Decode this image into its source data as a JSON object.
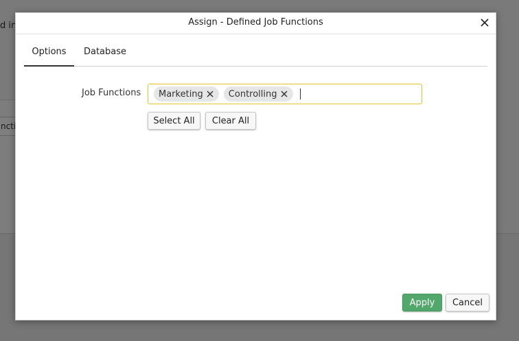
{
  "background": {
    "partial_text_top": "d in",
    "partial_field_text": "ncti"
  },
  "dialog": {
    "title": "Assign - Defined Job Functions",
    "close_icon": "close-icon"
  },
  "tabs": [
    {
      "label": "Options",
      "active": true
    },
    {
      "label": "Database",
      "active": false
    }
  ],
  "form": {
    "job_functions_label": "Job Functions",
    "tags": [
      "Marketing",
      "Controlling"
    ],
    "input_value": "",
    "focus_border_color": "#e4c42a",
    "select_all_label": "Select All",
    "clear_all_label": "Clear All"
  },
  "footer": {
    "apply_label": "Apply",
    "cancel_label": "Cancel",
    "apply_color": "#52a86b"
  }
}
